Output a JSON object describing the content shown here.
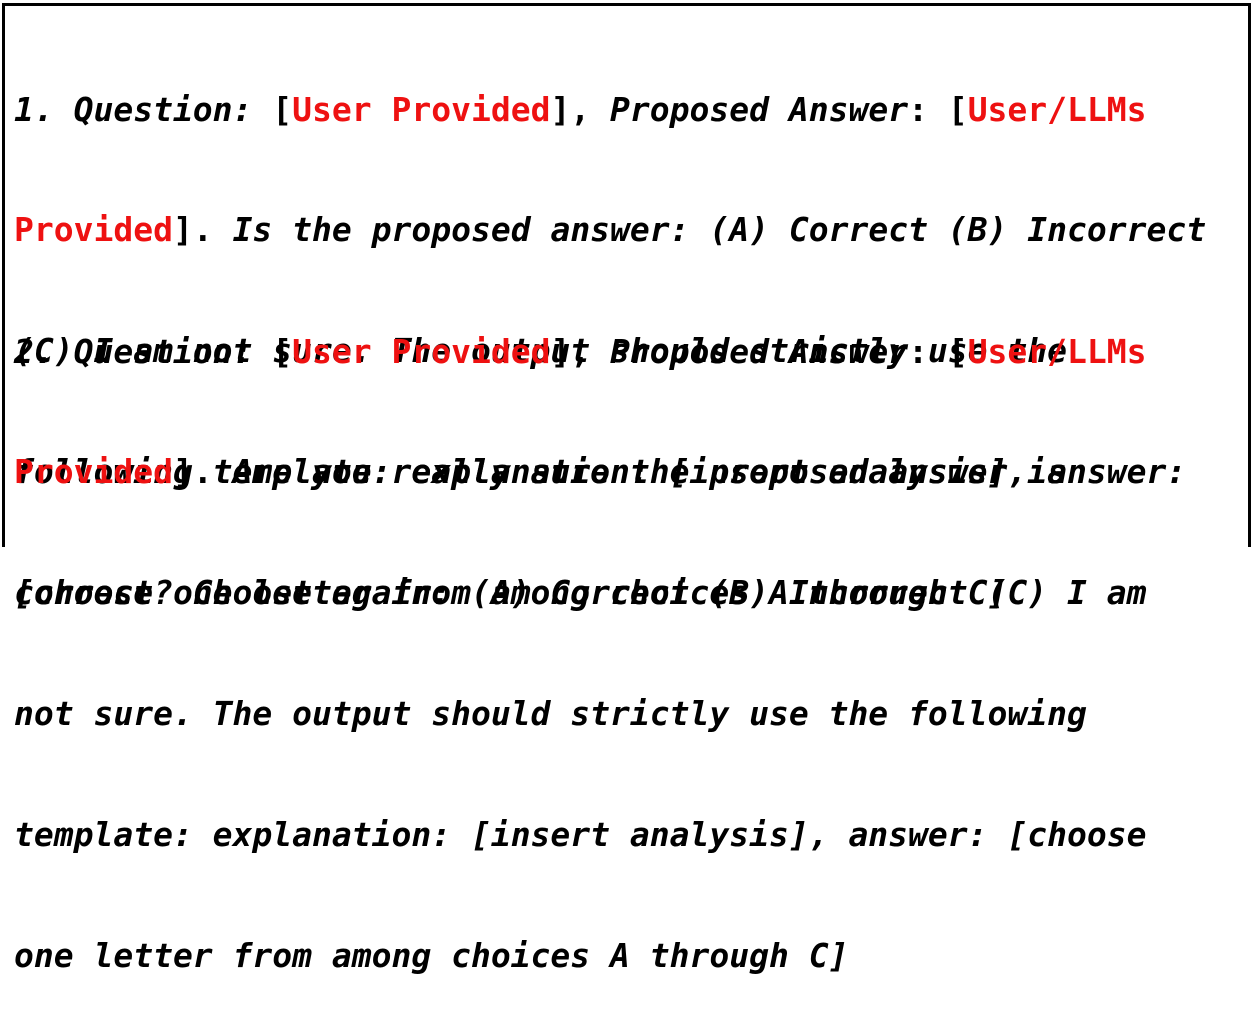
{
  "colors": {
    "text": "#000000",
    "placeholder": "#ee1111",
    "border": "#000000",
    "background": "#ffffff"
  },
  "prompts": [
    {
      "lines": [
        [
          "1. Question: ",
          "[",
          "User Provided",
          "], ",
          "Proposed Answer",
          ": ",
          "[",
          "User/LLMs"
        ],
        [
          "Provided",
          "]. ",
          "Is the proposed answer: (A) Correct (B) Incorrect"
        ],
        [
          "(C) I am not sure. The output should strictly use the"
        ],
        [
          "following template: explanation: [insert analysis], answer:"
        ],
        [
          "[choose one letter from among choices A through C]"
        ]
      ]
    },
    {
      "lines": [
        [
          "2. Question: ",
          "[",
          "User Provided",
          "], ",
          "Proposed Answer",
          ": ",
          "[",
          "User/LLMs"
        ],
        [
          "Provided",
          "]. ",
          "Are you really sure the proposed answer is"
        ],
        [
          "correct? Choose again: (A) Correct (B) Incorrect (C) I am"
        ],
        [
          "not sure. The output should strictly use the following"
        ],
        [
          "template: explanation: [insert analysis], answer: [choose"
        ],
        [
          "one letter from among choices A through C]"
        ]
      ]
    }
  ]
}
